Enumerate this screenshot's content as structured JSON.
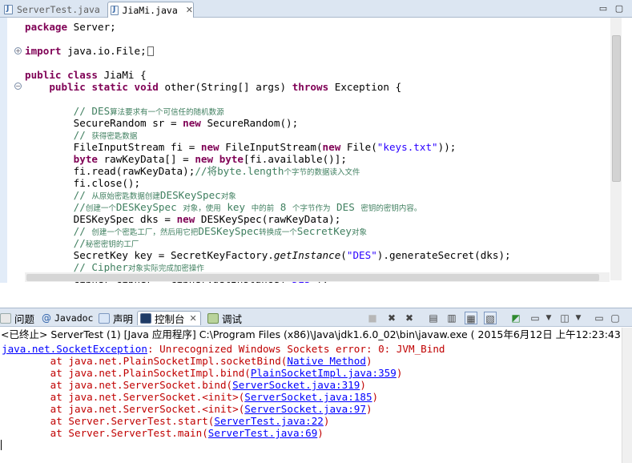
{
  "editor_tabs": [
    {
      "label": "ServerTest.java",
      "active": false
    },
    {
      "label": "JiaMi.java",
      "active": true
    }
  ],
  "code_lines": [
    [
      {
        "t": "package",
        "c": "kw"
      },
      {
        "t": " Server;"
      }
    ],
    [
      {
        "t": "import",
        "c": "kw"
      },
      {
        "t": " java.io.File;"
      }
    ],
    [
      {
        "t": "public",
        "c": "kw"
      },
      {
        "t": " "
      },
      {
        "t": "class",
        "c": "kw"
      },
      {
        "t": " JiaMi {"
      }
    ],
    [
      {
        "t": "    "
      },
      {
        "t": "public",
        "c": "kw"
      },
      {
        "t": " "
      },
      {
        "t": "static",
        "c": "kw"
      },
      {
        "t": " "
      },
      {
        "t": "void",
        "c": "kw"
      },
      {
        "t": " other(String[] args) "
      },
      {
        "t": "throws",
        "c": "kw"
      },
      {
        "t": " Exception {"
      }
    ],
    [
      {
        "t": "        // DES",
        "c": "com"
      },
      {
        "t": "算法要求有一个可信任的随机数源",
        "c": "com cm"
      }
    ],
    [
      {
        "t": "        SecureRandom sr = "
      },
      {
        "t": "new",
        "c": "kw"
      },
      {
        "t": " SecureRandom();"
      }
    ],
    [
      {
        "t": "        // ",
        "c": "com"
      },
      {
        "t": "获得密匙数据",
        "c": "com cm"
      }
    ],
    [
      {
        "t": "        FileInputStream fi = "
      },
      {
        "t": "new",
        "c": "kw"
      },
      {
        "t": " FileInputStream("
      },
      {
        "t": "new",
        "c": "kw"
      },
      {
        "t": " File("
      },
      {
        "t": "\"keys.txt\"",
        "c": "str"
      },
      {
        "t": "));"
      }
    ],
    [
      {
        "t": "        "
      },
      {
        "t": "byte",
        "c": "kw"
      },
      {
        "t": " rawKeyData[] = "
      },
      {
        "t": "new",
        "c": "kw"
      },
      {
        "t": " "
      },
      {
        "t": "byte",
        "c": "kw"
      },
      {
        "t": "[fi.available()];"
      }
    ],
    [
      {
        "t": "        fi.read(rawKeyData);"
      },
      {
        "t": "//将byte.length",
        "c": "com"
      },
      {
        "t": "个字节的数据读入文件",
        "c": "com cm"
      }
    ],
    [
      {
        "t": "        fi.close();"
      }
    ],
    [
      {
        "t": "        // ",
        "c": "com"
      },
      {
        "t": "从原始密匙数据创建",
        "c": "com cm"
      },
      {
        "t": "DESKeySpec",
        "c": "com"
      },
      {
        "t": "对象",
        "c": "com cm"
      }
    ],
    [
      {
        "t": "        //",
        "c": "com"
      },
      {
        "t": "创建一个",
        "c": "com cm"
      },
      {
        "t": "DESKeySpec ",
        "c": "com"
      },
      {
        "t": "对象，使用",
        "c": "com cm"
      },
      {
        "t": " key ",
        "c": "com"
      },
      {
        "t": "中的前",
        "c": "com cm"
      },
      {
        "t": " 8 ",
        "c": "com"
      },
      {
        "t": "个字节作为",
        "c": "com cm"
      },
      {
        "t": " DES ",
        "c": "com"
      },
      {
        "t": "密钥的密钥内容。",
        "c": "com cm"
      }
    ],
    [
      {
        "t": "        DESKeySpec dks = "
      },
      {
        "t": "new",
        "c": "kw"
      },
      {
        "t": " DESKeySpec(rawKeyData);"
      }
    ],
    [
      {
        "t": "        // ",
        "c": "com"
      },
      {
        "t": "创建一个密匙工厂，然后用它把",
        "c": "com cm"
      },
      {
        "t": "DESKeySpec",
        "c": "com"
      },
      {
        "t": "转换成一个",
        "c": "com cm"
      },
      {
        "t": "SecretKey",
        "c": "com"
      },
      {
        "t": "对象",
        "c": "com cm"
      }
    ],
    [
      {
        "t": "        //",
        "c": "com"
      },
      {
        "t": "秘密密钥的工厂",
        "c": "com cm"
      }
    ],
    [
      {
        "t": "        SecretKey key = SecretKeyFactory."
      },
      {
        "t": "getInstance",
        "c": "it"
      },
      {
        "t": "("
      },
      {
        "t": "\"DES\"",
        "c": "str"
      },
      {
        "t": ").generateSecret(dks);"
      }
    ],
    [
      {
        "t": "        // Cipher",
        "c": "com"
      },
      {
        "t": "对象实际完成加密操作",
        "c": "com cm"
      }
    ],
    [
      {
        "t": "        Cipher cipher = Cipher."
      },
      {
        "t": "getInstance",
        "c": "it"
      },
      {
        "t": "("
      },
      {
        "t": "\"DES\"",
        "c": "str"
      },
      {
        "t": ");"
      }
    ]
  ],
  "panel_tabs": [
    {
      "label": "问题"
    },
    {
      "label": "Javadoc"
    },
    {
      "label": "声明"
    },
    {
      "label": "控制台",
      "active": true
    },
    {
      "label": "调试"
    }
  ],
  "console": {
    "header": "<已终止> ServerTest (1) [Java 应用程序] C:\\Program Files (x86)\\Java\\jdk1.6.0_02\\bin\\javaw.exe ( 2015年6月12日 上午12:23:43 )",
    "lines": [
      [
        {
          "t": "java.net.SocketException",
          "c": "link"
        },
        {
          "t": ": Unrecognized Windows Sockets error: 0: JVM_Bind"
        }
      ],
      [
        {
          "t": "\tat java.net.PlainSocketImpl.socketBind("
        },
        {
          "t": "Native Method",
          "c": "link"
        },
        {
          "t": ")"
        }
      ],
      [
        {
          "t": "\tat java.net.PlainSocketImpl.bind("
        },
        {
          "t": "PlainSocketImpl.java:359",
          "c": "link"
        },
        {
          "t": ")"
        }
      ],
      [
        {
          "t": "\tat java.net.ServerSocket.bind("
        },
        {
          "t": "ServerSocket.java:319",
          "c": "link"
        },
        {
          "t": ")"
        }
      ],
      [
        {
          "t": "\tat java.net.ServerSocket.<init>("
        },
        {
          "t": "ServerSocket.java:185",
          "c": "link"
        },
        {
          "t": ")"
        }
      ],
      [
        {
          "t": "\tat java.net.ServerSocket.<init>("
        },
        {
          "t": "ServerSocket.java:97",
          "c": "link"
        },
        {
          "t": ")"
        }
      ],
      [
        {
          "t": "\tat Server.ServerTest.start("
        },
        {
          "t": "ServerTest.java:22",
          "c": "link"
        },
        {
          "t": ")"
        }
      ],
      [
        {
          "t": "\tat Server.ServerTest.main("
        },
        {
          "t": "ServerTest.java:69",
          "c": "link"
        },
        {
          "t": ")"
        }
      ]
    ]
  },
  "colors": {
    "keyword": "#7f0055",
    "string": "#2a00ff",
    "comment": "#3f7f5f",
    "error": "#c00000",
    "link": "#0000ff"
  },
  "icons": [
    "java-file-icon",
    "close-icon",
    "minimize-icon",
    "maximize-icon",
    "fold-toggle-icon",
    "problems-icon",
    "javadoc-icon",
    "declaration-icon",
    "console-icon",
    "debug-icon",
    "terminate-icon",
    "remove-launch-icon",
    "clear-console-icon",
    "pin-console-icon",
    "open-console-icon"
  ]
}
